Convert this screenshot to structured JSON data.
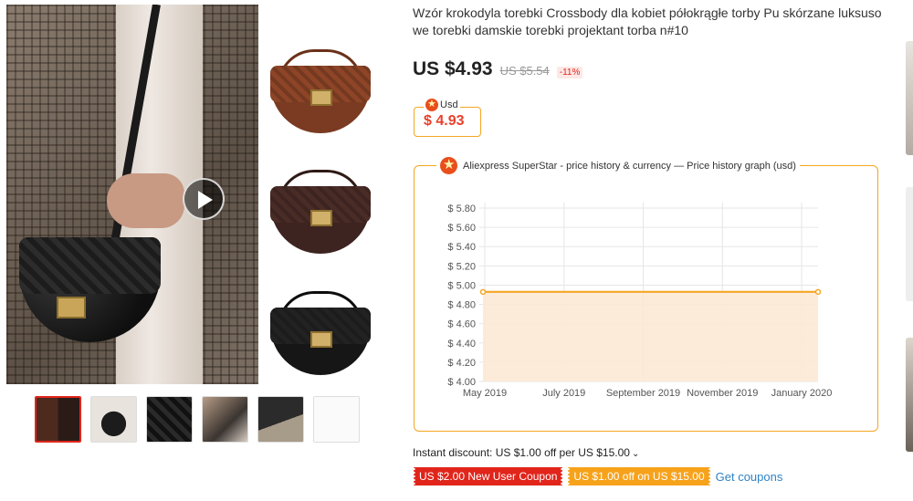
{
  "product": {
    "title": "Wzór krokodyla torebki Crossbody dla kobiet półokrągłe torby Pu skórzane luksuso we torebki damskie torebki projektant torba n#10",
    "price": "US $4.93",
    "old_price": "US $5.54",
    "discount": "-11%"
  },
  "currency_widget": {
    "label": "Usd",
    "value": "$ 4.93",
    "icon": "superstar-icon"
  },
  "gallery": {
    "main_icon": "play-icon",
    "side_colors": [
      "#7a3b22",
      "#3d2420",
      "#1a1a1a"
    ],
    "thumb_count": 6
  },
  "chart_data": {
    "type": "area",
    "title": "Aliexpress SuperStar - price history & currency — Price history graph (usd)",
    "x": [
      "May 2019",
      "July 2019",
      "September 2019",
      "November 2019",
      "January 2020"
    ],
    "y_ticks": [
      "$ 5.80",
      "$ 5.60",
      "$ 5.40",
      "$ 5.20",
      "$ 5.00",
      "$ 4.80",
      "$ 4.60",
      "$ 4.40",
      "$ 4.20",
      "$ 4.00"
    ],
    "series": [
      {
        "values": [
          4.93,
          4.93,
          4.93,
          4.93,
          4.93,
          4.93
        ]
      }
    ],
    "ylim": [
      4.0,
      5.8
    ],
    "grid": true,
    "color": "#f5a623"
  },
  "promo": {
    "instant_discount": "Instant discount: US $1.00 off per US $15.00",
    "coupons": [
      "US $2.00 New User Coupon",
      "US $1.00 off on US $15.00"
    ],
    "get_coupons": "Get coupons"
  }
}
